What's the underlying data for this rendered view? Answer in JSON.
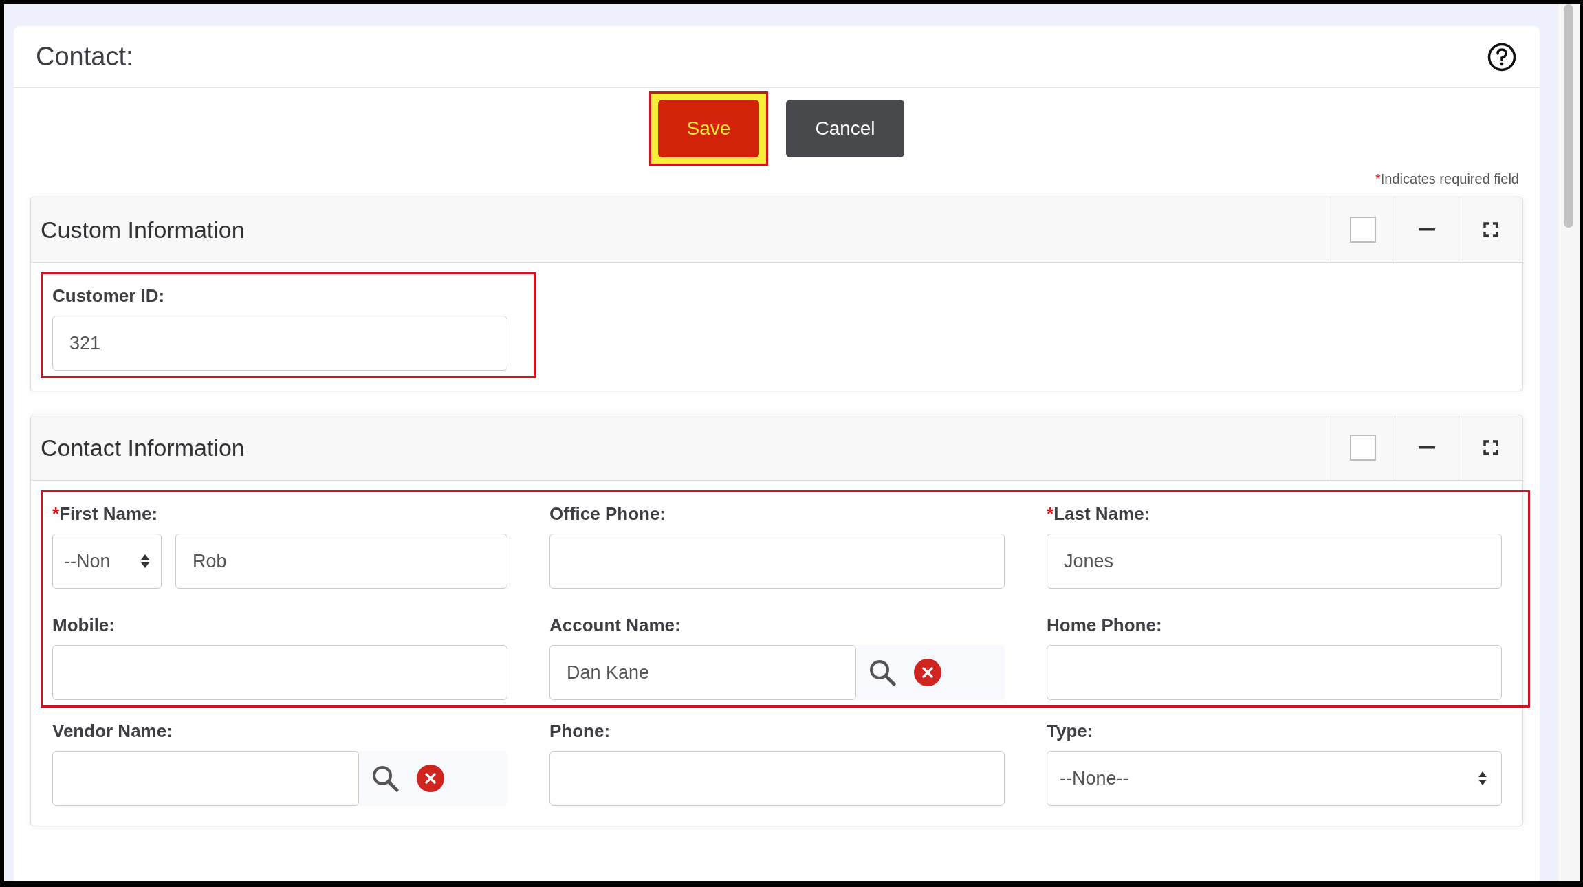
{
  "header": {
    "title": "Contact:"
  },
  "actions": [
    {
      "label": "Save",
      "kind": "primary",
      "highlighted": true
    },
    {
      "label": "Cancel",
      "kind": "secondary",
      "highlighted": false
    }
  ],
  "required_note": {
    "mark": "*",
    "text": "Indicates required field"
  },
  "required_mark": "*",
  "panels": [
    {
      "title": "Custom Information",
      "checked": false,
      "groups": [
        {
          "highlighted": true,
          "rows": [
            [
              {
                "label": "Customer ID:",
                "kind": "text",
                "required": false,
                "value": "321"
              }
            ]
          ]
        }
      ]
    },
    {
      "title": "Contact Information",
      "checked": false,
      "groups": [
        {
          "highlighted": true,
          "rows": [
            [
              {
                "label": "First Name:",
                "kind": "salutation_name",
                "required": true,
                "salutation": "--Non",
                "value": "Rob"
              },
              {
                "label": "Office Phone:",
                "kind": "text",
                "required": false
              },
              {
                "label": "Last Name:",
                "kind": "text",
                "required": true,
                "value": "Jones"
              }
            ],
            [
              {
                "label": "Mobile:",
                "kind": "text",
                "required": false
              },
              {
                "label": "Account Name:",
                "kind": "lookup",
                "required": false,
                "value": "Dan Kane"
              },
              {
                "label": "Home Phone:",
                "kind": "text",
                "required": false
              }
            ]
          ]
        },
        {
          "highlighted": false,
          "rows": [
            [
              {
                "label": "Vendor Name:",
                "kind": "lookup",
                "required": false
              },
              {
                "label": "Phone:",
                "kind": "text",
                "required": false
              },
              {
                "label": "Type:",
                "kind": "select",
                "required": false,
                "value": "--None--"
              }
            ]
          ]
        }
      ]
    }
  ]
}
